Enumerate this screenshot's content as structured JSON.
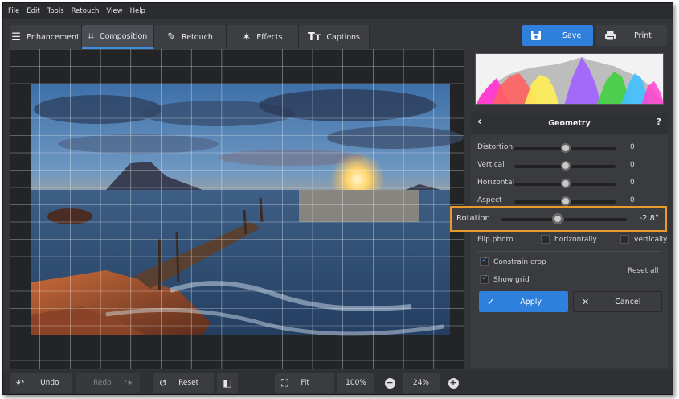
{
  "menu": [
    "File",
    "Edit",
    "Tools",
    "Retouch",
    "View",
    "Help"
  ],
  "tabs": [
    {
      "label": "Enhancement",
      "icon": "sliders-icon"
    },
    {
      "label": "Composition",
      "icon": "crop-icon"
    },
    {
      "label": "Retouch",
      "icon": "brush-icon"
    },
    {
      "label": "Effects",
      "icon": "magic-wand-icon"
    },
    {
      "label": "Captions",
      "icon": "text-icon"
    }
  ],
  "save_label": "Save",
  "print_label": "Print",
  "panel": {
    "title": "Geometry",
    "help": "?",
    "sliders": [
      {
        "label": "Distortion",
        "value": "0"
      },
      {
        "label": "Vertical",
        "value": "0"
      },
      {
        "label": "Horizontal",
        "value": "0"
      },
      {
        "label": "Aspect",
        "value": "0"
      }
    ],
    "rotation": {
      "label": "Rotation",
      "value": "-2.8°",
      "level": 0.45
    },
    "flip": {
      "label": "Flip photo",
      "horizontal": "horizontally",
      "vertical": "vertically"
    },
    "constrain_crop": "Constrain crop",
    "show_grid": "Show grid",
    "reset_all": "Reset all",
    "apply": "Apply",
    "cancel": "Cancel"
  },
  "bottom": {
    "undo": "Undo",
    "redo": "Redo",
    "reset": "Reset",
    "fit": "Fit",
    "zoom_100": "100%",
    "zoom_value": "24%"
  },
  "colors": {
    "accent": "#2f7fdc",
    "highlight": "#e89a2a"
  }
}
